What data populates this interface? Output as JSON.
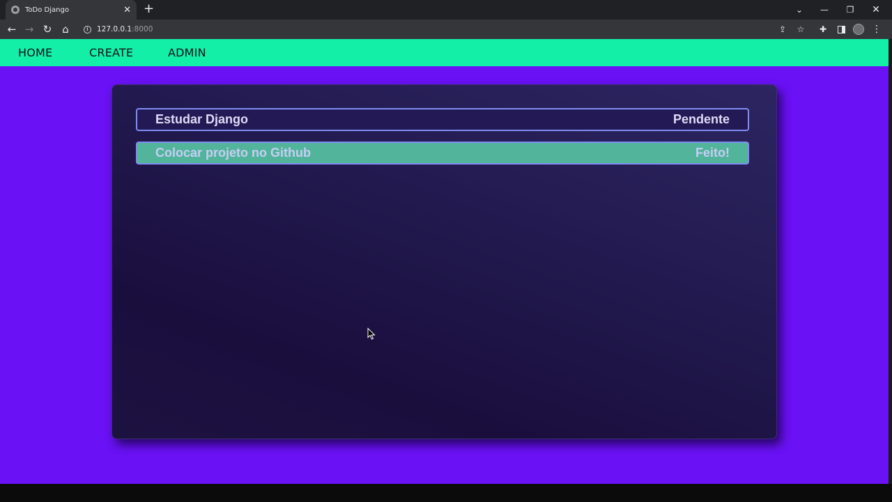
{
  "browser": {
    "tab_title": "ToDo Django",
    "tab_close": "✕",
    "new_tab": "+",
    "url_host": "127.0.0.1",
    "url_port": ":8000",
    "window_controls": {
      "tablist": "⌄",
      "minimize": "—",
      "restore": "❐",
      "close": "✕"
    },
    "icons": {
      "back": "←",
      "forward": "→",
      "reload": "↻",
      "home": "⌂",
      "share": "⇪",
      "star": "☆",
      "extensions": "✚",
      "menu": "⋮"
    }
  },
  "site": {
    "nav": {
      "home": "HOME",
      "create": "CREATE",
      "admin": "ADMIN"
    },
    "todos": [
      {
        "title": "Estudar Django",
        "status": "Pendente"
      },
      {
        "title": "Colocar projeto no Github",
        "status": "Feito!"
      }
    ]
  },
  "colors": {
    "page_background": "#6a11f5",
    "nav_background": "#14efa8",
    "done_item_background": "#52b59b",
    "item_border": "#7f8df2"
  }
}
